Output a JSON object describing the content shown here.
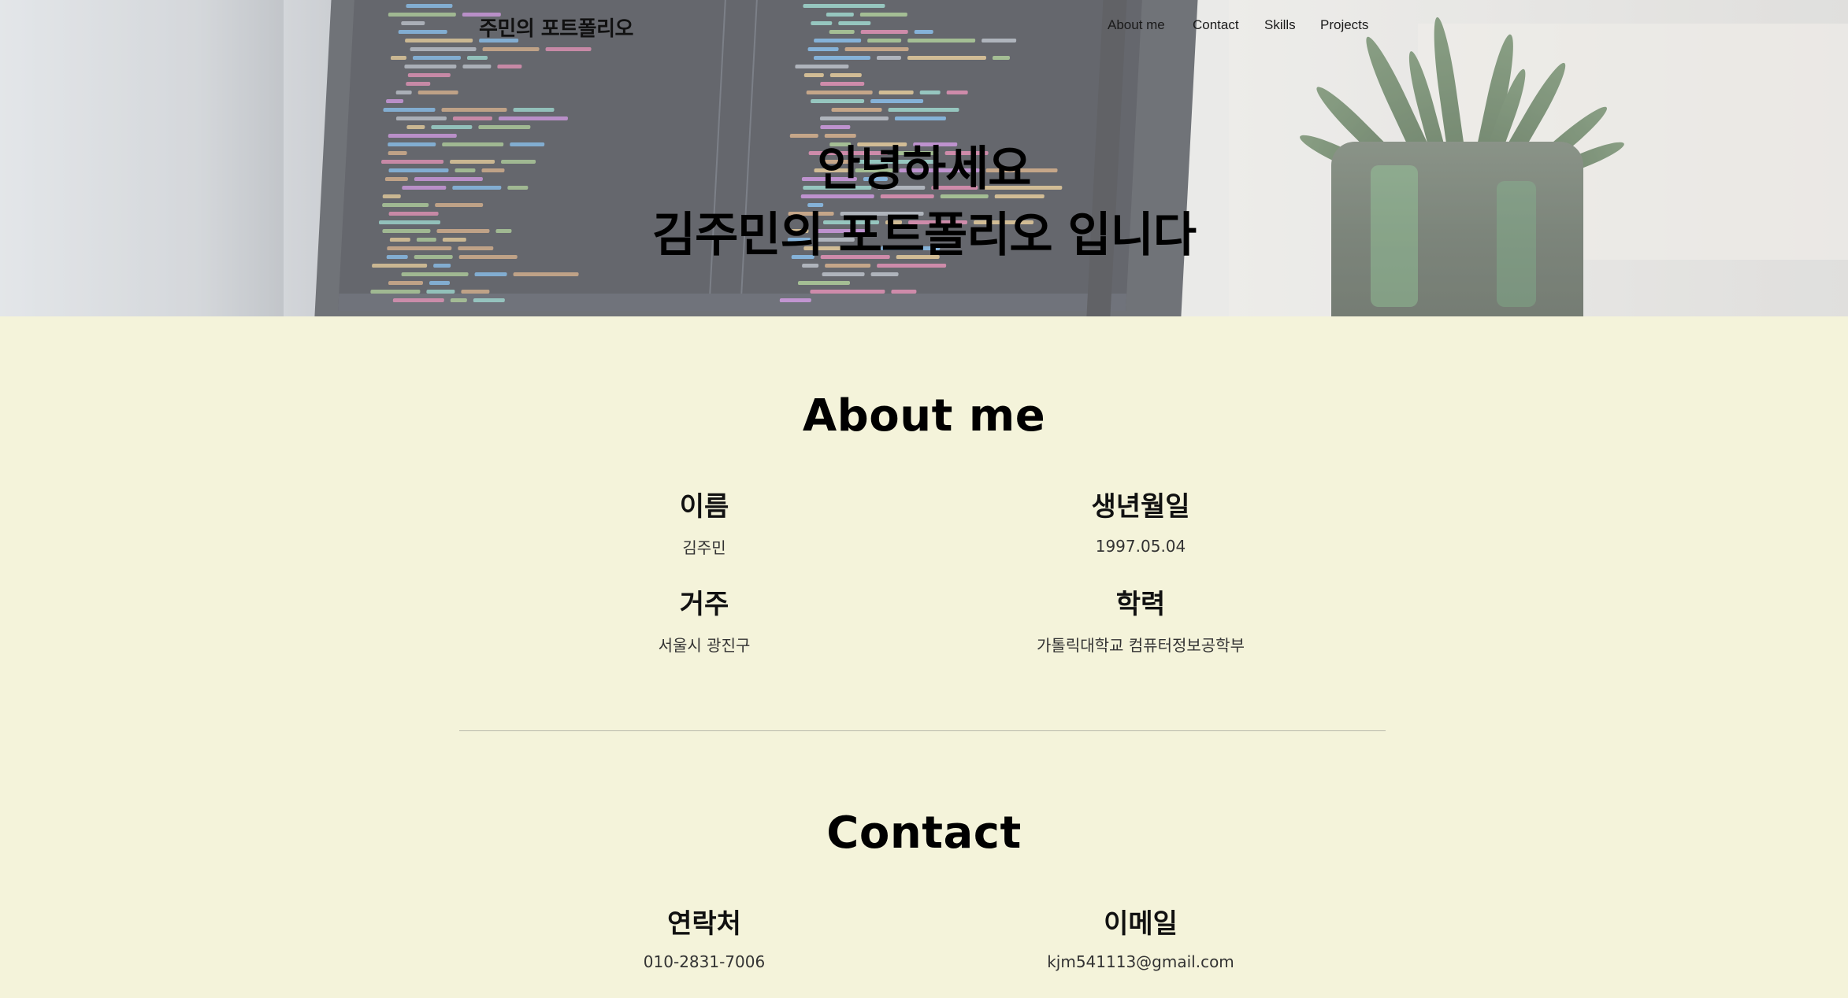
{
  "header": {
    "brand": "주민의 포트폴리오",
    "nav": [
      {
        "label": "About me"
      },
      {
        "label": "Contact"
      },
      {
        "label": "Skills"
      },
      {
        "label": "Projects"
      }
    ]
  },
  "hero": {
    "line1": "안녕하세요",
    "line2": "김주민의 포트폴리오 입니다"
  },
  "about": {
    "title": "About me",
    "fields": [
      {
        "label": "이름",
        "value": "김주민"
      },
      {
        "label": "생년월일",
        "value": "1997.05.04"
      },
      {
        "label": "거주",
        "value": "서울시 광진구"
      },
      {
        "label": "학력",
        "value": "가톨릭대학교 컴퓨터정보공학부"
      }
    ]
  },
  "contact": {
    "title": "Contact",
    "fields": [
      {
        "label": "연락처",
        "value": "010-2831-7006"
      },
      {
        "label": "이메일",
        "value": "kjm541113@gmail.com"
      }
    ]
  },
  "colors": {
    "page_bg": "#f4f3da",
    "text": "#000000",
    "divider": "#b8b8aa"
  }
}
